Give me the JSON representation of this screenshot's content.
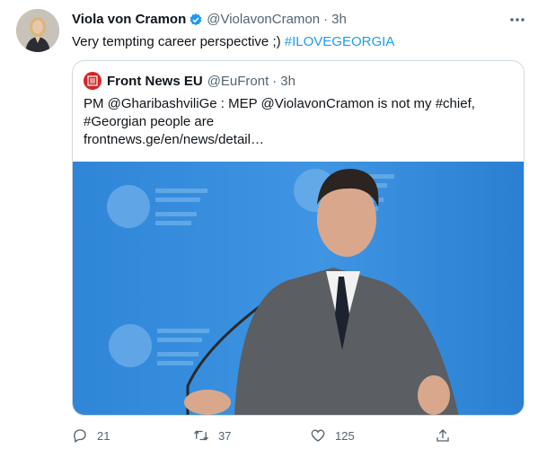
{
  "tweet": {
    "author_name": "Viola von Cramon",
    "author_handle": "@ViolavonCramon",
    "separator": "·",
    "time": "3h",
    "text": "Very tempting career perspective ;) ",
    "hashtag": "#ILOVEGEORGIA"
  },
  "quote": {
    "author_name": "Front News EU",
    "author_handle": "@EuFront",
    "separator": "·",
    "time": "3h",
    "lines": [
      "PM @GharibashviliGe : MEP @ViolavonCramon is not my #chief,",
      "#Georgian people are",
      "frontnews.ge/en/news/detail…"
    ]
  },
  "actions": {
    "reply_count": "21",
    "retweet_count": "37",
    "like_count": "125"
  },
  "icons": {
    "verified": "verified-badge-icon",
    "more": "more-dots-icon",
    "reply": "reply-icon",
    "retweet": "retweet-icon",
    "like": "heart-icon",
    "share": "share-icon"
  },
  "colors": {
    "accent": "#1d9bf0",
    "muted": "#536471",
    "border": "#cfd9de"
  }
}
